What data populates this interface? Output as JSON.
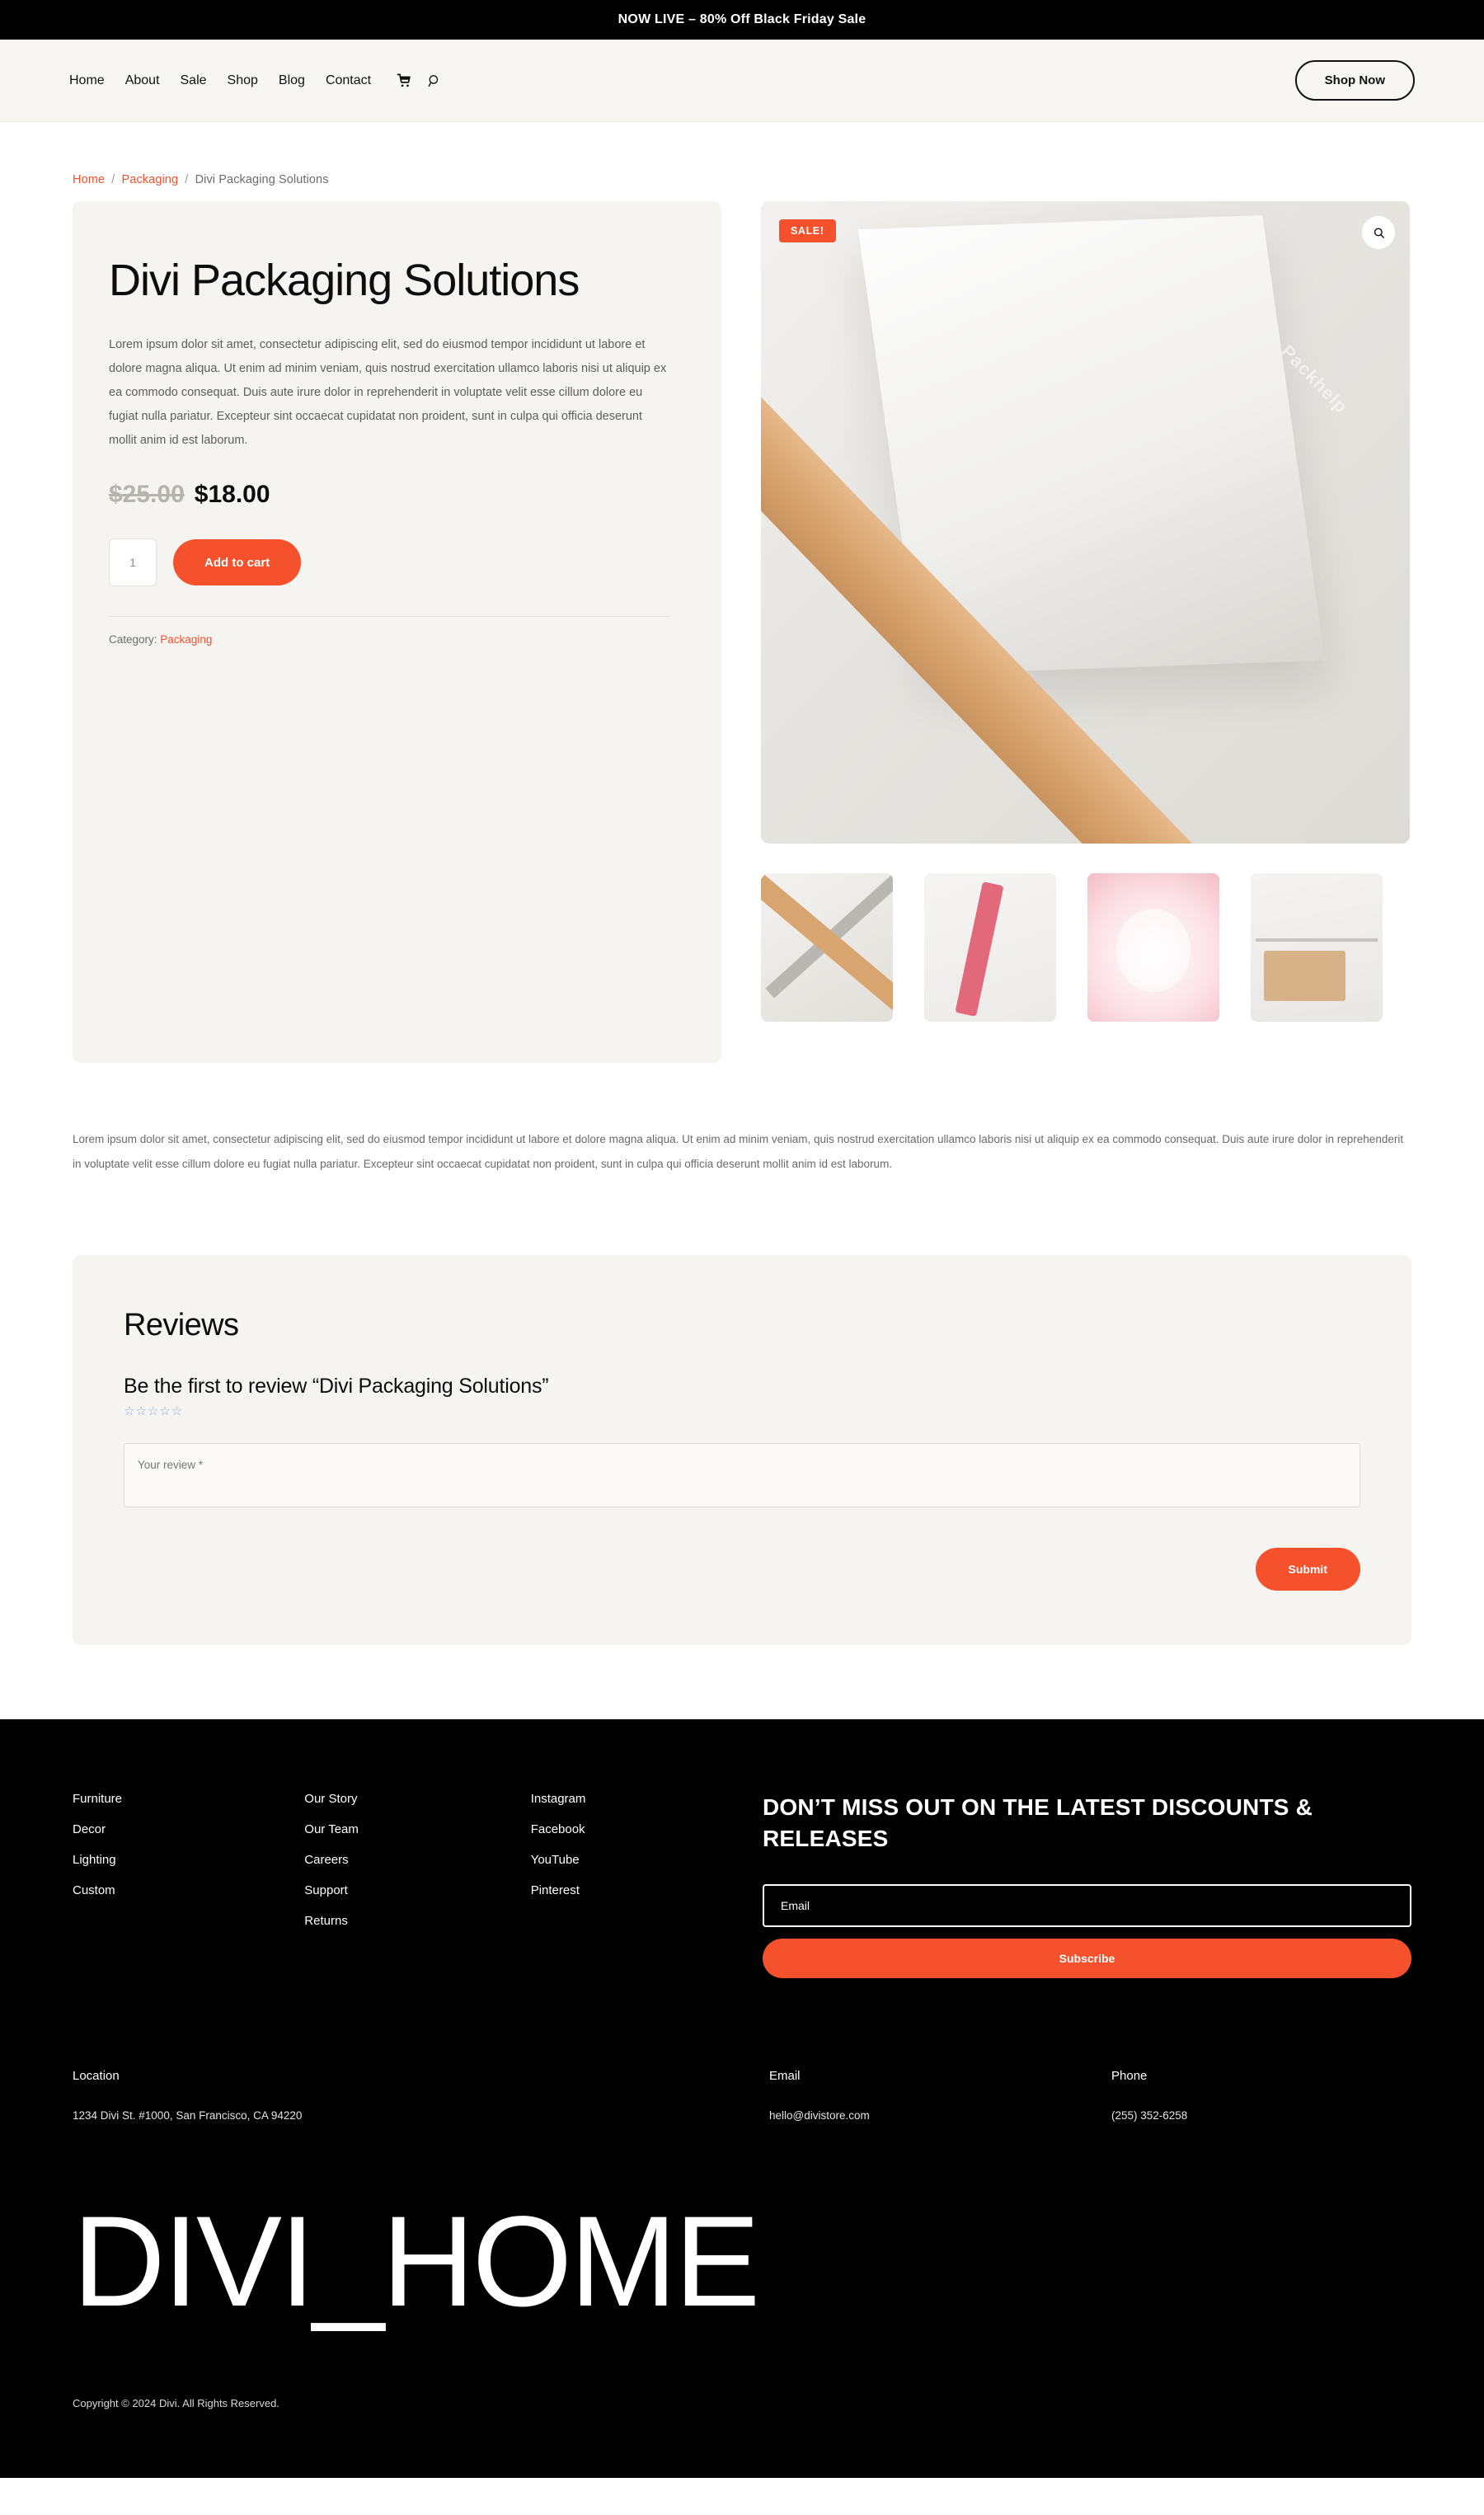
{
  "announcement": {
    "text": "NOW LIVE – 80% Off Black Friday Sale"
  },
  "header": {
    "nav": [
      {
        "label": "Home"
      },
      {
        "label": "About"
      },
      {
        "label": "Sale"
      },
      {
        "label": "Shop"
      },
      {
        "label": "Blog"
      },
      {
        "label": "Contact"
      }
    ],
    "icons": [
      {
        "name": "cart-icon"
      },
      {
        "name": "search-icon"
      }
    ],
    "cta": {
      "label": "Shop Now"
    }
  },
  "breadcrumb": {
    "home": "Home",
    "category": "Packaging",
    "current": "Divi Packaging Solutions",
    "separator": "/"
  },
  "product": {
    "title": "Divi Packaging Solutions",
    "description": "Lorem ipsum dolor sit amet, consectetur adipiscing elit, sed do eiusmod tempor incididunt ut labore et dolore magna aliqua. Ut enim ad minim veniam, quis nostrud exercitation ullamco laboris nisi ut aliquip ex ea commodo consequat. Duis aute irure dolor in reprehenderit in voluptate velit esse cillum dolore eu fugiat nulla pariatur. Excepteur sint occaecat cupidatat non proident, sunt in culpa qui officia deserunt mollit anim id est laborum.",
    "price_old": "$25.00",
    "price_new": "$18.00",
    "quantity": "1",
    "add_to_cart_label": "Add to cart",
    "category_label": "Category:",
    "category_value": "Packaging",
    "sale_badge": "SALE!",
    "zoom_icon": "magnifier-icon",
    "thumbnails": [
      {
        "name": "thumbnail-tape-cross"
      },
      {
        "name": "thumbnail-pink-ribbon"
      },
      {
        "name": "thumbnail-confetti-plate"
      },
      {
        "name": "thumbnail-kraft-tags"
      }
    ]
  },
  "long_description": "Lorem ipsum dolor sit amet, consectetur adipiscing elit, sed do eiusmod tempor incididunt ut labore et dolore magna aliqua. Ut enim ad minim veniam, quis nostrud exercitation ullamco laboris nisi ut aliquip ex ea commodo consequat. Duis aute irure dolor in reprehenderit in voluptate velit esse cillum dolore eu fugiat nulla pariatur. Excepteur sint occaecat cupidatat non proident, sunt in culpa qui officia deserunt mollit anim id est laborum.",
  "reviews": {
    "heading": "Reviews",
    "prompt": "Be the first to review “Divi Packaging Solutions”",
    "stars": "☆☆☆☆☆",
    "star_count": 5,
    "review_placeholder": "Your review *",
    "submit_label": "Submit"
  },
  "footer": {
    "col1": [
      {
        "label": "Furniture"
      },
      {
        "label": "Decor"
      },
      {
        "label": "Lighting"
      },
      {
        "label": "Custom"
      }
    ],
    "col2": [
      {
        "label": "Our Story"
      },
      {
        "label": "Our Team"
      },
      {
        "label": "Careers"
      },
      {
        "label": "Support"
      },
      {
        "label": "Returns"
      }
    ],
    "col3": [
      {
        "label": "Instagram"
      },
      {
        "label": "Facebook"
      },
      {
        "label": "YouTube"
      },
      {
        "label": "Pinterest"
      }
    ],
    "newsletter": {
      "heading": "DON’T MISS OUT ON THE LATEST DISCOUNTS & RELEASES",
      "email_placeholder": "Email",
      "subscribe_label": "Subscribe"
    },
    "contact": {
      "location_label": "Location",
      "location_value": "1234 Divi St. #1000, San Francisco, CA 94220",
      "email_label": "Email",
      "email_value": "hello@divistore.com",
      "phone_label": "Phone",
      "phone_value": "(255) 352-6258"
    },
    "brand": "DIVI_HOME",
    "copyright": "Copyright © 2024 Divi. All Rights Reserved."
  },
  "colors": {
    "accent": "#f4512c",
    "dark": "#000000",
    "panel": "#f5f4f0",
    "header_bg": "#f7f6f2",
    "star": "#86b0de"
  }
}
